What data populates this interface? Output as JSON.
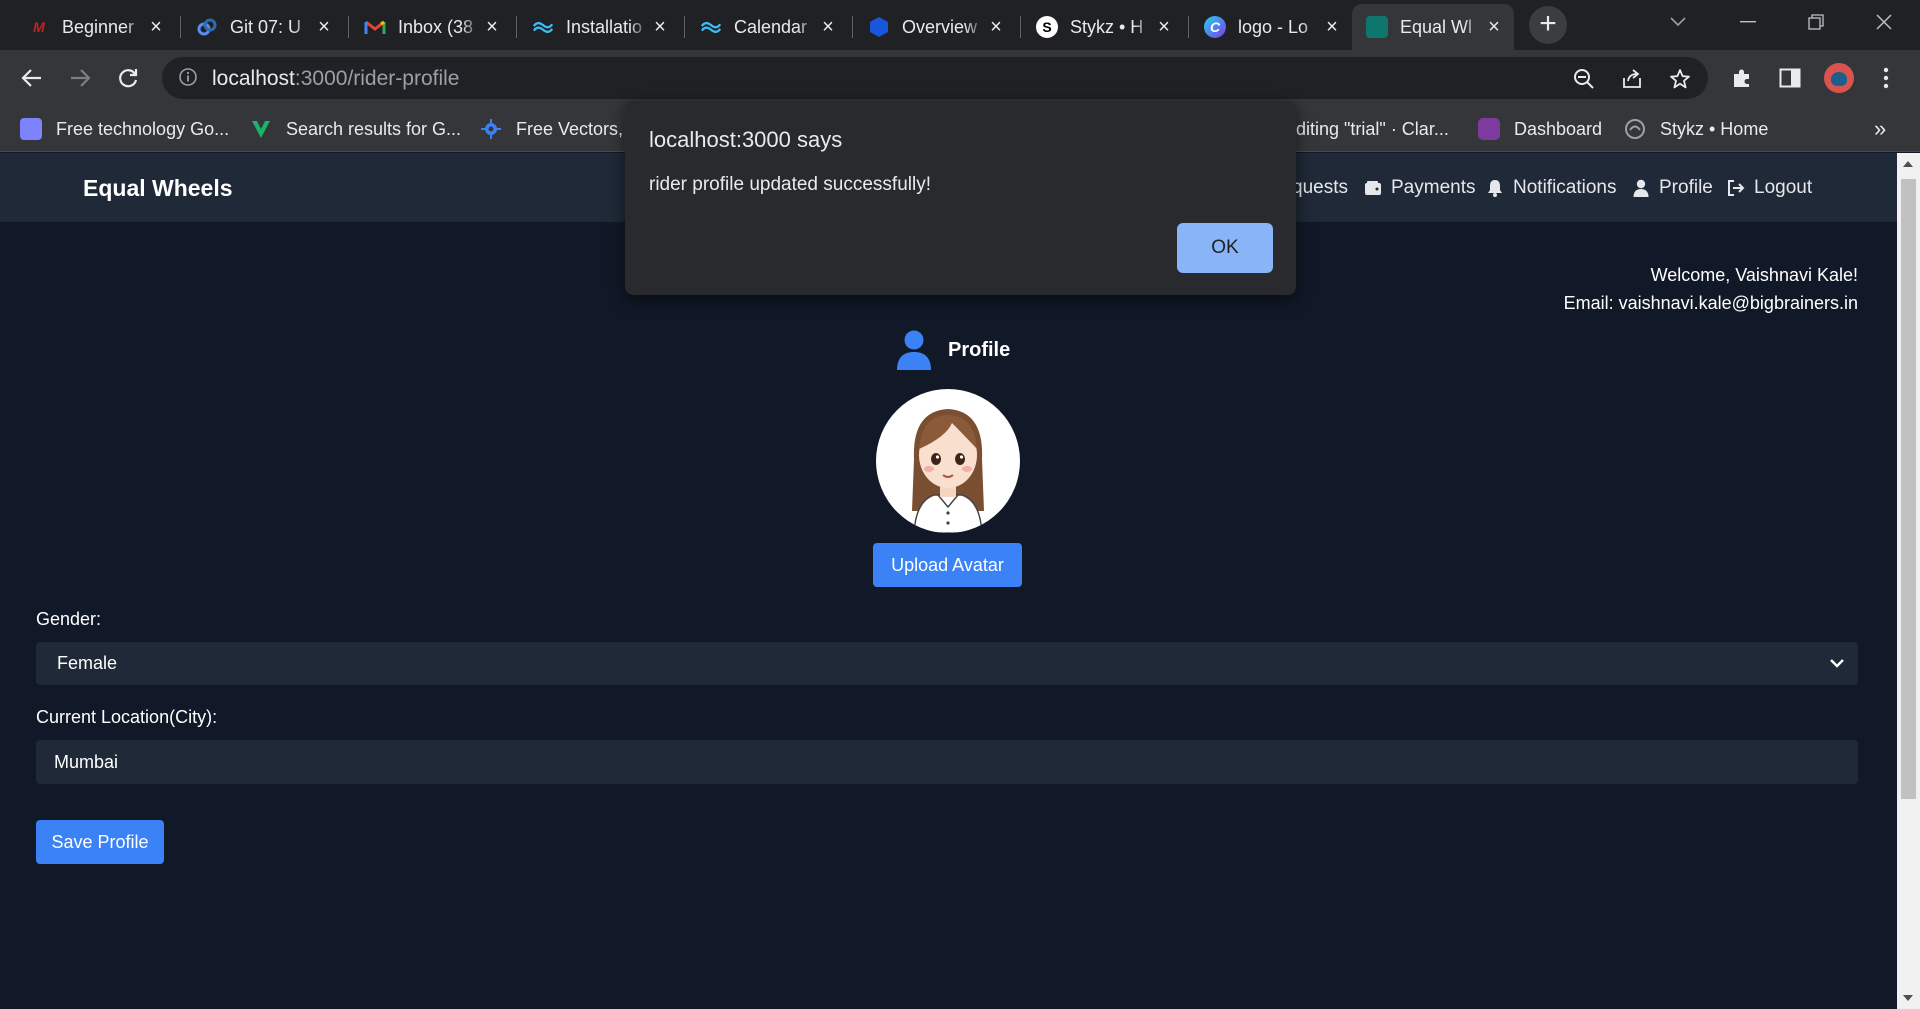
{
  "browser": {
    "tabs": [
      {
        "title": "Beginner",
        "icon": "youtube-like-m-icon",
        "color": "#c5221f"
      },
      {
        "title": "Git 07: U",
        "icon": "git-link-icon",
        "color": "#2b6cb0"
      },
      {
        "title": "Inbox (38",
        "icon": "gmail-icon",
        "color": "#ea4335"
      },
      {
        "title": "Installatio",
        "icon": "tailwind-icon",
        "color": "#38bdf8"
      },
      {
        "title": "Calendar",
        "icon": "tailwind-icon",
        "color": "#38bdf8"
      },
      {
        "title": "Overview",
        "icon": "hexagon-icon",
        "color": "#1a56db"
      },
      {
        "title": "Stykz • H",
        "icon": "stykz-icon",
        "color": "#000000"
      },
      {
        "title": "logo - Lo",
        "icon": "canva-icon",
        "color": "#7c3aed"
      },
      {
        "title": "Equal Wl",
        "icon": "app-icon",
        "color": "#0f766e",
        "active": true
      }
    ],
    "url_host": "localhost",
    "url_path": ":3000/rider-profile",
    "bookmarks": [
      {
        "label": "Free technology Go...",
        "icon": "building-icon",
        "color": "#7c83fd"
      },
      {
        "label": "Search results for G...",
        "icon": "vuetify-icon",
        "color": "#1bb26a"
      },
      {
        "label": "Free Vectors, S",
        "icon": "freepik-icon",
        "color": "#3b82f6"
      },
      {
        "label": "diting \"trial\" · Clar...",
        "icon": "",
        "color": ""
      },
      {
        "label": "Dashboard",
        "icon": "dashboard-icon",
        "color": "#a855f7"
      },
      {
        "label": "Stykz • Home",
        "icon": "stykz-icon",
        "color": "#9aa0a6"
      }
    ]
  },
  "app": {
    "brand": "Equal Wheels",
    "nav": [
      {
        "label": "quests",
        "icon": ""
      },
      {
        "label": "Payments",
        "icon": "wallet-icon"
      },
      {
        "label": "Notifications",
        "icon": "bell-icon"
      },
      {
        "label": "Profile",
        "icon": "user-icon"
      },
      {
        "label": "Logout",
        "icon": "logout-icon"
      }
    ],
    "welcome": "Welcome, Vaishnavi Kale!",
    "email": "Email: vaishnavi.kale@bigbrainers.in",
    "profile_heading": "Profile",
    "upload_label": "Upload Avatar",
    "gender_label": "Gender:",
    "gender_value": "Female",
    "location_label": "Current Location(City):",
    "location_value": "Mumbai",
    "save_label": "Save Profile",
    "accent": "#3b82f6"
  },
  "dialog": {
    "title": "localhost:3000 says",
    "message": "rider profile updated successfully!",
    "ok_label": "OK"
  }
}
